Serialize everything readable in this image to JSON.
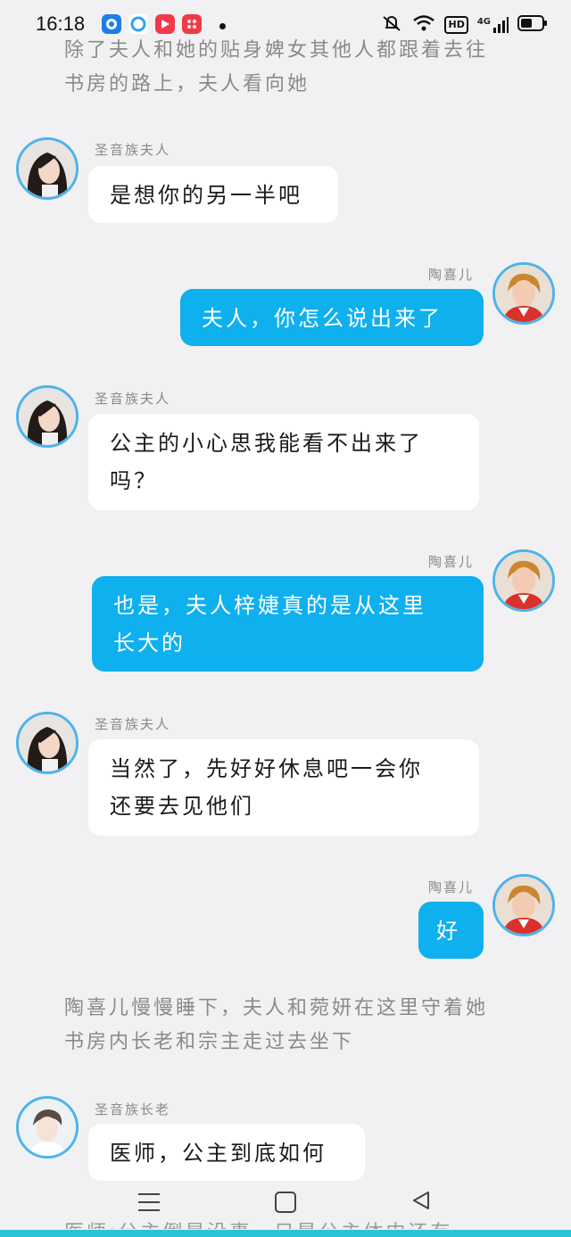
{
  "status_bar": {
    "time": "16:18",
    "app_icons": [
      "tencent-video-icon",
      "qq-browser-icon",
      "video-player-icon",
      "taobao-icon"
    ],
    "system_icons": [
      "mute-alarm-icon",
      "wifi-icon",
      "hd-icon",
      "signal-4g-icon",
      "battery-icon"
    ],
    "hd_label": "HD",
    "network_label": "4G"
  },
  "narrations": [
    {
      "lines": [
        "除了夫人和她的贴身婢女其他人都跟着去往",
        "书房的路上，夫人看向她"
      ]
    },
    {
      "lines": [
        "陶喜儿慢慢睡下，夫人和菀妍在这里守着她",
        "书房内长老和宗主走过去坐下"
      ]
    }
  ],
  "messages": [
    {
      "speaker": "圣音族夫人",
      "side": "left",
      "lines": [
        "是想你的另一半吧"
      ]
    },
    {
      "speaker": "陶喜儿",
      "side": "right",
      "lines": [
        "夫人，你怎么说出来了"
      ]
    },
    {
      "speaker": "圣音族夫人",
      "side": "left",
      "lines": [
        "公主的小心思我能看不出来了",
        "吗？"
      ]
    },
    {
      "speaker": "陶喜儿",
      "side": "right",
      "lines": [
        "也是，夫人梓婕真的是从这里",
        "长大的"
      ]
    },
    {
      "speaker": "圣音族夫人",
      "side": "left",
      "lines": [
        "当然了，先好好休息吧一会你",
        "还要去见他们"
      ]
    },
    {
      "speaker": "陶喜儿",
      "side": "right",
      "lines": [
        "好"
      ]
    },
    {
      "speaker": "圣音族长老",
      "side": "left",
      "lines": [
        "医师，公主到底如何"
      ]
    }
  ],
  "partial_text": "医师:公主倒是没事，只是公主体内还有",
  "colors": {
    "background": "#f1f1f3",
    "right_bubble": "#0fb0ee",
    "left_bubble": "#ffffff",
    "avatar_ring": "#4eb3ea",
    "narration_text": "#8a8a8a"
  }
}
